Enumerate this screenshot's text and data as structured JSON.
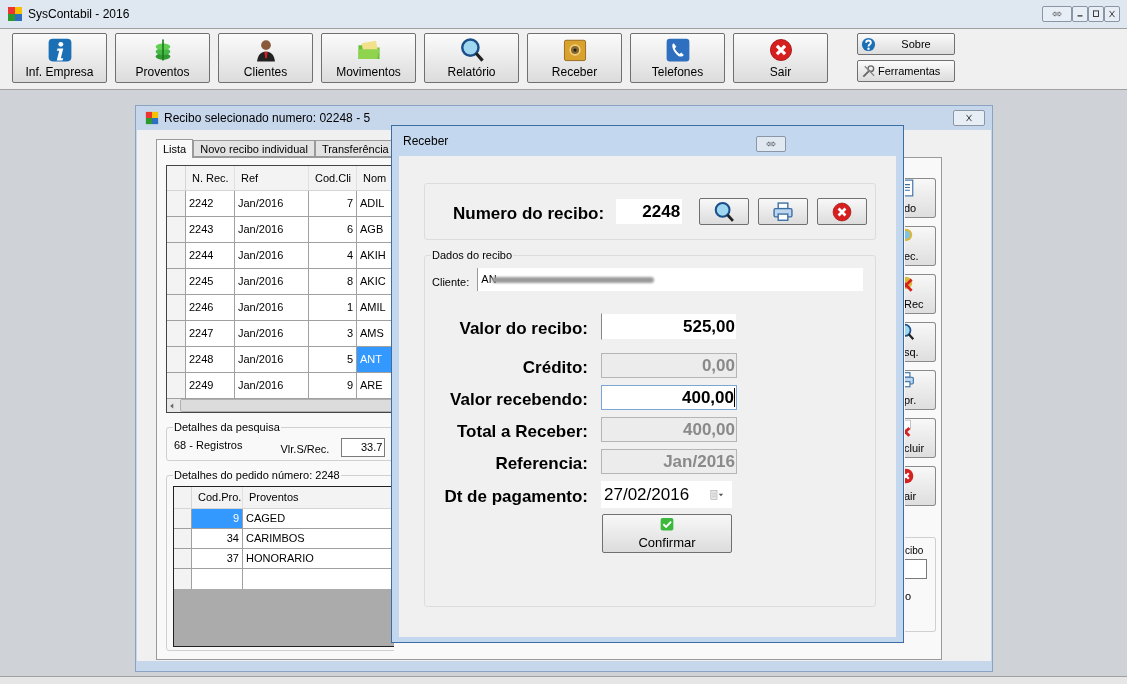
{
  "app": {
    "title": "SysContabil - 2016"
  },
  "toolbar": [
    {
      "label": "Inf. Empresa",
      "kind": "info"
    },
    {
      "label": "Proventos",
      "kind": "money"
    },
    {
      "label": "Clientes",
      "kind": "person"
    },
    {
      "label": "Movimentos",
      "kind": "folders"
    },
    {
      "label": "Relatório",
      "kind": "search"
    },
    {
      "label": "Receber",
      "kind": "safe"
    },
    {
      "label": "Telefones",
      "kind": "phone"
    },
    {
      "label": "Sair",
      "kind": "close"
    }
  ],
  "side_buttons": [
    {
      "label": "Sobre",
      "kind": "help"
    },
    {
      "label": "Ferramentas",
      "kind": "tools"
    }
  ],
  "list_window": {
    "title": "Recibo selecionado numero: 02248 - 5",
    "tabs": [
      {
        "label": "Lista",
        "selected": true
      },
      {
        "label": "Novo recibo individual",
        "selected": false
      },
      {
        "label": "Transferência",
        "selected": false
      }
    ],
    "grid": {
      "columns": [
        "N. Rec.",
        "Ref",
        "Cod.Cli",
        "Nom"
      ],
      "rows": [
        {
          "cells": [
            "2242",
            "Jan/2016",
            "7",
            "ADIL"
          ],
          "selected": false
        },
        {
          "cells": [
            "2243",
            "Jan/2016",
            "6",
            "AGB"
          ],
          "selected": false
        },
        {
          "cells": [
            "2244",
            "Jan/2016",
            "4",
            "AKIH"
          ],
          "selected": false
        },
        {
          "cells": [
            "2245",
            "Jan/2016",
            "8",
            "AKIC"
          ],
          "selected": false
        },
        {
          "cells": [
            "2246",
            "Jan/2016",
            "1",
            "AMIL"
          ],
          "selected": false
        },
        {
          "cells": [
            "2247",
            "Jan/2016",
            "3",
            "AMS"
          ],
          "selected": false
        },
        {
          "cells": [
            "2248",
            "Jan/2016",
            "5",
            "ANT"
          ],
          "selected": true
        },
        {
          "cells": [
            "2249",
            "Jan/2016",
            "9",
            "ARE"
          ],
          "selected": false
        }
      ]
    },
    "search_details": {
      "title": "Detalhes da pesquisa",
      "count": "68 - Registros",
      "label": "Vlr.S/Rec.",
      "value": "33.7"
    },
    "order_details": {
      "title": "Detalhes do pedido número: 2248",
      "columns": [
        "Cod.Pro.",
        "Proventos"
      ],
      "rows": [
        {
          "cells": [
            "9",
            "CAGED"
          ],
          "selected": true
        },
        {
          "cells": [
            "34",
            "CARIMBOS"
          ],
          "selected": false
        },
        {
          "cells": [
            "37",
            "HONORARIO"
          ],
          "selected": false
        }
      ]
    },
    "action_buttons": [
      {
        "label": "do",
        "kind": "doc"
      },
      {
        "label": "ec.",
        "kind": "magnifier"
      },
      {
        "label": "Rec",
        "kind": "cancel"
      },
      {
        "label": "sq.",
        "kind": "search"
      },
      {
        "label": "pr.",
        "kind": "print"
      },
      {
        "label": "cluir",
        "kind": "delete"
      },
      {
        "label": "air",
        "kind": "exit"
      }
    ],
    "receipt_box": {
      "label": "cibo",
      "note": "o"
    }
  },
  "dialog": {
    "title": "Receber",
    "number_label": "Numero do recibo:",
    "number": "2248",
    "tools": [
      {
        "kind": "search"
      },
      {
        "kind": "print"
      },
      {
        "kind": "close"
      }
    ],
    "data_group": "Dados do recibo",
    "client_label": "Cliente:",
    "client_value": "AN",
    "client_redacted": true,
    "fields": [
      {
        "label": "Valor do recibo:",
        "value": "525,00",
        "kind": "money",
        "disabled": false,
        "focused": false
      },
      {
        "label": "Crédito:",
        "value": "0,00",
        "kind": "money",
        "disabled": true,
        "focused": false
      },
      {
        "label": "Valor recebendo:",
        "value": "400,00",
        "kind": "money",
        "disabled": false,
        "focused": true
      },
      {
        "label": "Total a Receber:",
        "value": "400,00",
        "kind": "money",
        "disabled": true,
        "focused": false
      },
      {
        "label": "Referencia:",
        "value": "Jan/2016",
        "kind": "money",
        "disabled": true,
        "focused": false
      },
      {
        "label": "Dt de pagamento:",
        "value": "27/02/2016",
        "kind": "date",
        "disabled": false,
        "focused": false
      }
    ],
    "confirm": "Confirmar"
  }
}
